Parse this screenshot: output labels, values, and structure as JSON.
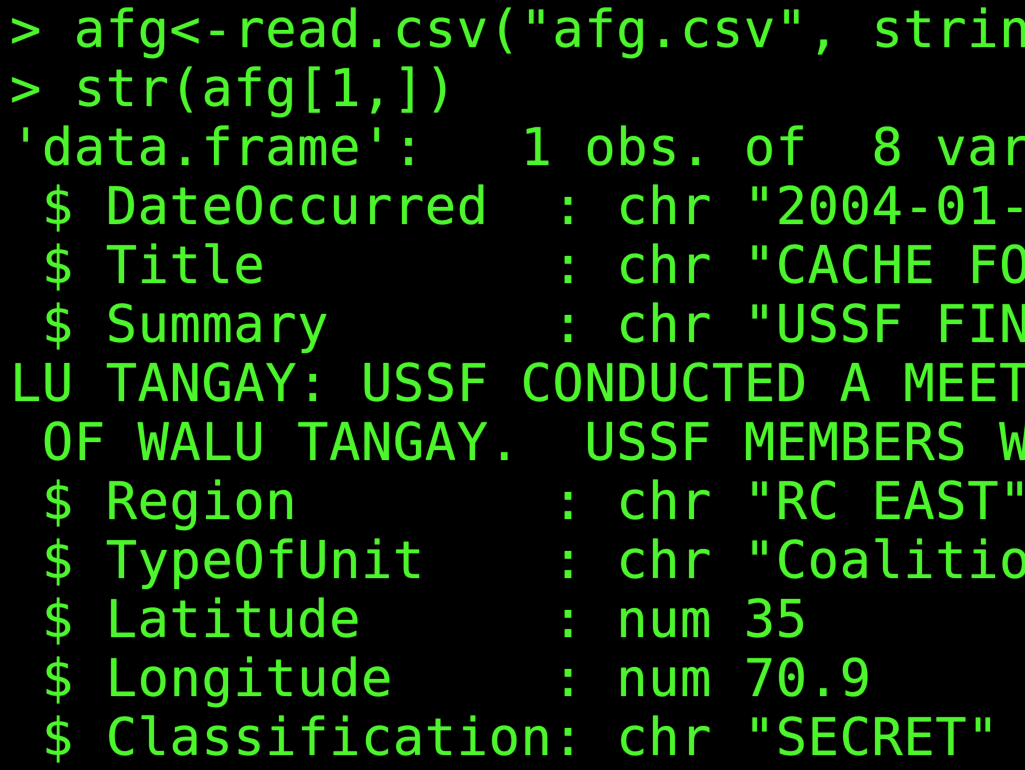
{
  "terminal": {
    "fg_color": "#4cf52c",
    "bg_color": "#000000",
    "lines": [
      "> afg<-read.csv(\"afg.csv\", strin",
      "> str(afg[1,])",
      "'data.frame':   1 obs. of  8 var",
      " $ DateOccurred  : chr \"2004-01-",
      " $ Title         : chr \"CACHE FO",
      " $ Summary       : chr \"USSF FIN",
      "LU TANGAY: USSF CONDUCTED A MEET",
      " OF WALU TANGAY.  USSF MEMBERS W",
      " $ Region        : chr \"RC EAST\"",
      " $ TypeOfUnit    : chr \"Coalitio",
      " $ Latitude      : num 35",
      " $ Longitude     : num 70.9",
      " $ Classification: chr \"SECRET\""
    ]
  }
}
